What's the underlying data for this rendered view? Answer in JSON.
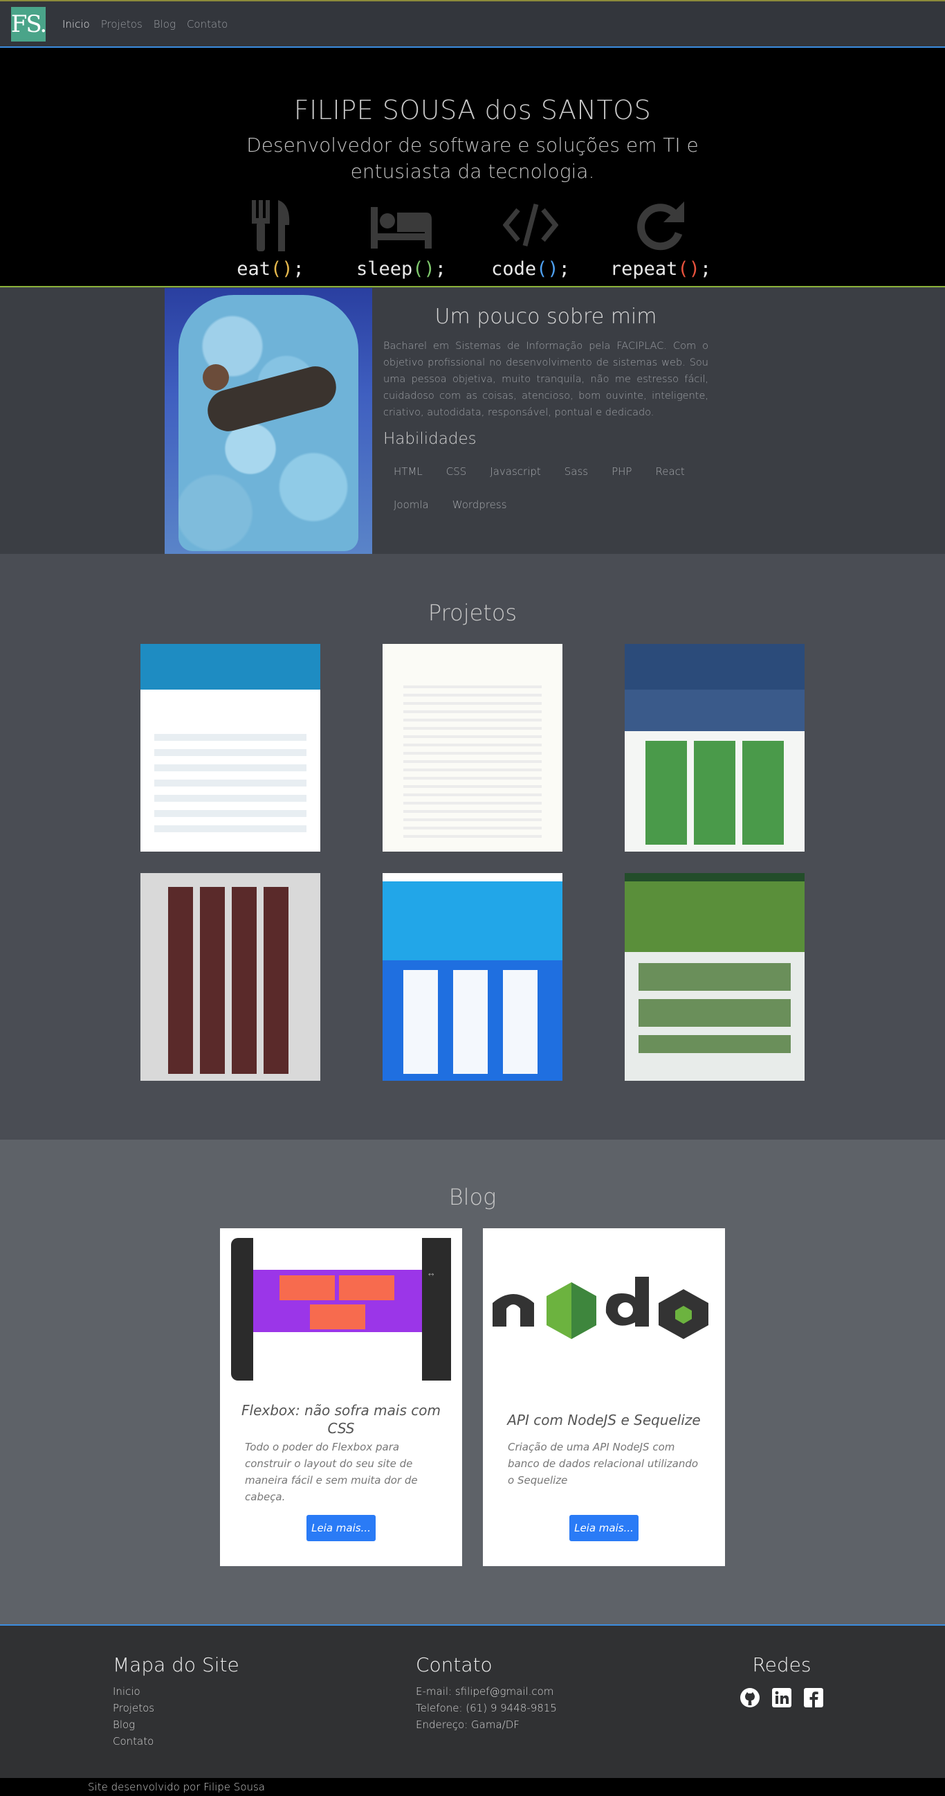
{
  "nav": {
    "logo": "FS.",
    "links": [
      "Inicio",
      "Projetos",
      "Blog",
      "Contato"
    ]
  },
  "hero": {
    "name": "FILIPE SOUSA dos SANTOS",
    "subtitle": "Desenvolvedor de software e soluções em TI e entusiasta da tecnologia.",
    "code": [
      {
        "word": "eat",
        "paren": "()",
        "end": ";",
        "icon": "fork-knife-icon",
        "color": "#e6b94d"
      },
      {
        "word": "sleep",
        "paren": "()",
        "end": ";",
        "icon": "bed-icon",
        "color": "#7ec86c"
      },
      {
        "word": "code",
        "paren": "()",
        "end": ";",
        "icon": "code-icon",
        "color": "#4ea0f0"
      },
      {
        "word": "repeat",
        "paren": "()",
        "end": ";",
        "icon": "redo-icon",
        "color": "#e8523d"
      }
    ]
  },
  "about": {
    "title": "Um pouco sobre mim",
    "text": "Bacharel em Sistemas de Informação pela FACIPLAC. Com o objetivo profissional no desenvolvimento de sistemas web. Sou uma pessoa objetiva, muito tranquila, não me estresso fácil, cuidadoso com as coisas, atencioso, bom ouvinte, inteligente, criativo, autodidata, responsável, pontual e dedicado.",
    "skills_title": "Habilidades",
    "skills": [
      "HTML",
      "CSS",
      "Javascript",
      "Sass",
      "PHP",
      "React",
      "Joomla",
      "Wordpress"
    ]
  },
  "projects": {
    "title": "Projetos"
  },
  "blog": {
    "title": "Blog",
    "posts": [
      {
        "title": "Flexbox: não sofra mais com CSS",
        "text": "Todo o poder do Flexbox para construir o layout do seu site de maneira fácil e sem muita dor de cabeça.",
        "button": "Leia mais..."
      },
      {
        "title": "API com NodeJS e Sequelize",
        "text": "Criação de uma API NodeJS com banco de dados relacional utilizando o Sequelize",
        "button": "Leia mais..."
      }
    ]
  },
  "footer": {
    "sitemap_title": "Mapa do Site",
    "sitemap": [
      "Inicio",
      "Projetos",
      "Blog",
      "Contato"
    ],
    "contact_title": "Contato",
    "contact": [
      "E-mail: sfilipef@gmail.com",
      "Telefone: (61) 9 9448-9815",
      "Endereço: Gama/DF"
    ],
    "social_title": "Redes",
    "social_icons": [
      "github-icon",
      "linkedin-icon",
      "facebook-icon"
    ],
    "copyright": "Site desenvolvido por Filipe Sousa"
  }
}
